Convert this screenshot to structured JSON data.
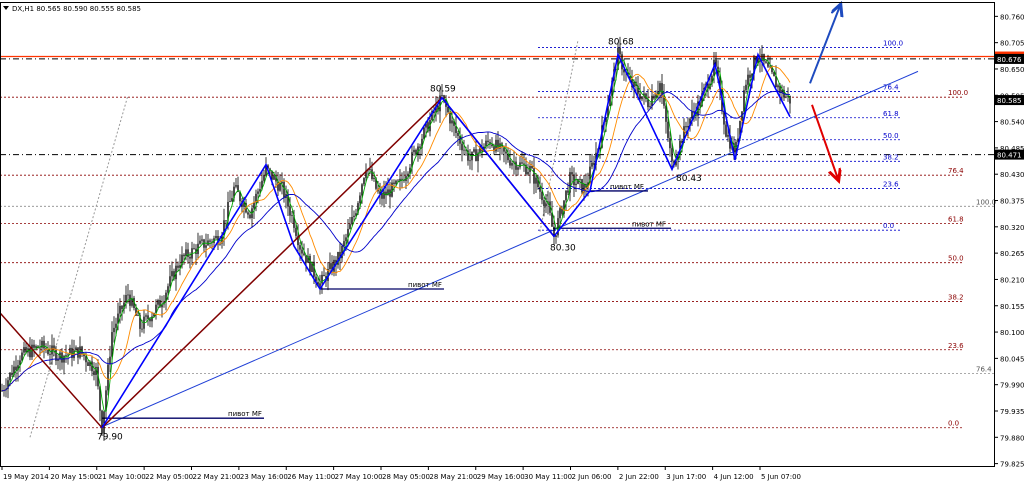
{
  "chart_data": {
    "type": "candlestick",
    "title": "DX,H1  80.565 80.590 80.555 80.585",
    "symbol": "DX,H1",
    "ohlc_readout": "80.565 80.590 80.555 80.585",
    "ylim": [
      79.82,
      80.79
    ],
    "y_ticks": [
      "80.760",
      "80.705",
      "80.650",
      "80.595",
      "80.540",
      "80.485",
      "80.430",
      "80.375",
      "80.320",
      "80.265",
      "80.210",
      "80.155",
      "80.100",
      "80.045",
      "79.990",
      "79.935",
      "79.880",
      "79.825"
    ],
    "x_ticks": [
      "19 May 2014",
      "20 May 15:00",
      "21 May 10:00",
      "22 May 05:00",
      "22 May 21:00",
      "23 May 16:00",
      "26 May 11:00",
      "27 May 10:00",
      "28 May 05:00",
      "28 May 21:00",
      "29 May 16:00",
      "30 May 11:00",
      "2 Jun 06:00",
      "2 Jun 22:00",
      "3 Jun 17:00",
      "4 Jun 12:00",
      "5 Jun 07:00"
    ],
    "price_tags": [
      {
        "price": 80.676,
        "label": "80.676",
        "color": "#ff3300"
      },
      {
        "price": 80.671,
        "label": "80.676",
        "color": "#000000"
      },
      {
        "price": 80.585,
        "label": "80.585",
        "color": "#000000"
      },
      {
        "price": 80.471,
        "label": "80.471",
        "color": "#000000"
      }
    ],
    "pivots": [
      {
        "label": "79.90",
        "price": 79.9
      },
      {
        "label": "80.59",
        "price": 80.59
      },
      {
        "label": "80.30",
        "price": 80.3
      },
      {
        "label": "80.68",
        "price": 80.68
      },
      {
        "label": "80.43",
        "price": 80.43
      }
    ],
    "pivot_mf_label": "пивот MF",
    "fib_red_levels": [
      {
        "label": "100.0",
        "price": 80.591
      },
      {
        "label": "76.4",
        "price": 80.428
      },
      {
        "label": "61.8",
        "price": 80.327
      },
      {
        "label": "50.0",
        "price": 80.245
      },
      {
        "label": "38.2",
        "price": 80.164
      },
      {
        "label": "23.6",
        "price": 80.063
      },
      {
        "label": "0.0",
        "price": 79.9
      }
    ],
    "fib_blue_levels": [
      {
        "label": "100.0",
        "price": 80.695
      },
      {
        "label": "76.4",
        "price": 80.603
      },
      {
        "label": "61.8",
        "price": 80.548
      },
      {
        "label": "50.0",
        "price": 80.502
      },
      {
        "label": "38.2",
        "price": 80.457
      },
      {
        "label": "23.6",
        "price": 80.4
      },
      {
        "label": "0.0",
        "price": 80.313
      }
    ],
    "fib_gray_levels": [
      {
        "label": "100.0",
        "price": 80.363
      },
      {
        "label": "76.4",
        "price": 80.013
      }
    ],
    "colors": {
      "background": "#ffffff",
      "candle": "#000000",
      "ma_fast": "#00aa00",
      "ma_mid": "#ff8c00",
      "ma_slow": "#0000cc",
      "zigzag_blue": "#0000ff",
      "zigzag_dark": "#800000",
      "fib_red": "#8b0000",
      "fib_blue": "#0000cc",
      "arrow_up": "#1e4bbf",
      "arrow_down": "#e00000"
    }
  }
}
